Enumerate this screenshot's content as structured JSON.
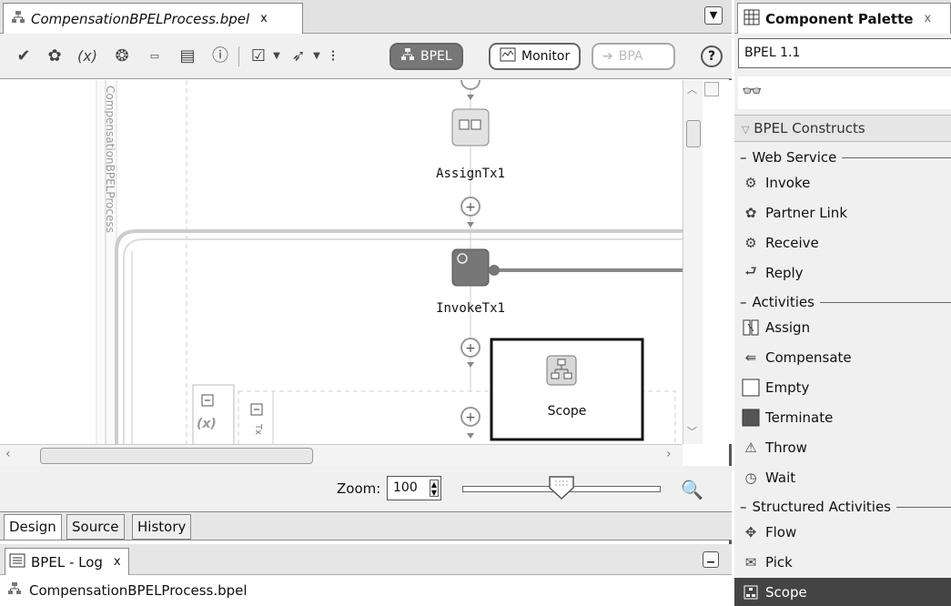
{
  "editor": {
    "tab_title": "CompensationBPELProcess.bpel",
    "tab_close": "x",
    "toolbar": {
      "modes": [
        {
          "label": "BPEL",
          "state": "active"
        },
        {
          "label": "Monitor",
          "state": "idle"
        },
        {
          "label": "BPA",
          "state": "disabled"
        }
      ],
      "help": "?"
    },
    "canvas": {
      "scope_lane_label": "CompensationBPELProcess",
      "activities": [
        {
          "name": "AssignTx1",
          "icon": "assign-icon"
        },
        {
          "name": "InvokeTx1",
          "icon": "invoke-icon"
        }
      ],
      "drag_preview_label": "Scope",
      "variables_label": "(x)",
      "inner_scope_label": "Tx"
    },
    "zoom": {
      "label": "Zoom:",
      "value": "100",
      "slider_level_percent": 50
    },
    "view_tabs": [
      "Design",
      "Source",
      "History"
    ],
    "active_view_tab": "Design",
    "log": {
      "tab_title": "BPEL - Log",
      "tab_close": "x",
      "entry": "CompensationBPELProcess.bpel"
    }
  },
  "palette": {
    "title": "Component Palette",
    "close": "x",
    "selector_value": "BPEL 1.1",
    "category": "BPEL Constructs",
    "groups": [
      {
        "name": "Web Service",
        "items": [
          "Invoke",
          "Partner Link",
          "Receive",
          "Reply"
        ]
      },
      {
        "name": "Activities",
        "items": [
          "Assign",
          "Compensate",
          "Empty",
          "Terminate",
          "Throw",
          "Wait"
        ]
      },
      {
        "name": "Structured Activities",
        "items": [
          "Flow",
          "Pick",
          "Scope"
        ]
      }
    ],
    "selected_item": "Scope"
  }
}
